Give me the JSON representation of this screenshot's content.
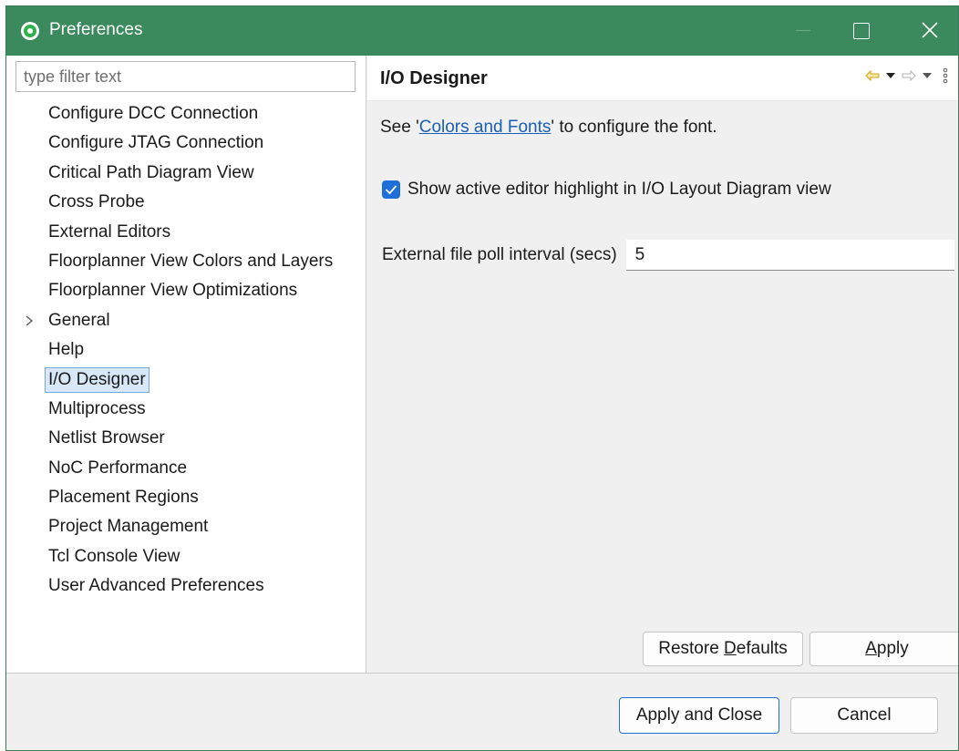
{
  "window": {
    "title": "Preferences",
    "accent_color": "#3a8a5e",
    "icons": [
      "app-logo-icon",
      "maximize-icon",
      "close-icon"
    ]
  },
  "filter": {
    "placeholder": "type filter text",
    "value": ""
  },
  "tree": {
    "items": [
      {
        "label": "Configure DCC Connection",
        "expandable": false,
        "selected": false
      },
      {
        "label": "Configure JTAG Connection",
        "expandable": false,
        "selected": false
      },
      {
        "label": "Critical Path Diagram View",
        "expandable": false,
        "selected": false
      },
      {
        "label": "Cross Probe",
        "expandable": false,
        "selected": false
      },
      {
        "label": "External Editors",
        "expandable": false,
        "selected": false
      },
      {
        "label": "Floorplanner View Colors and Layers",
        "expandable": false,
        "selected": false
      },
      {
        "label": "Floorplanner View Optimizations",
        "expandable": false,
        "selected": false
      },
      {
        "label": "General",
        "expandable": true,
        "selected": false
      },
      {
        "label": "Help",
        "expandable": false,
        "selected": false
      },
      {
        "label": "I/O Designer",
        "expandable": false,
        "selected": true
      },
      {
        "label": "Multiprocess",
        "expandable": false,
        "selected": false
      },
      {
        "label": "Netlist Browser",
        "expandable": false,
        "selected": false
      },
      {
        "label": "NoC Performance",
        "expandable": false,
        "selected": false
      },
      {
        "label": "Placement Regions",
        "expandable": false,
        "selected": false
      },
      {
        "label": "Project Management",
        "expandable": false,
        "selected": false
      },
      {
        "label": "Tcl Console View",
        "expandable": false,
        "selected": false
      },
      {
        "label": "User Advanced Preferences",
        "expandable": false,
        "selected": false
      }
    ]
  },
  "page": {
    "title": "I/O Designer",
    "desc_prefix": "See '",
    "desc_link": "Colors and Fonts",
    "desc_suffix": "' to configure the font.",
    "checkbox_label": "Show active editor highlight in I/O Layout Diagram view",
    "checkbox_checked": true,
    "poll_label": "External file poll interval (secs)",
    "poll_value": "5",
    "nav_icons": [
      "back-arrow-icon",
      "dropdown-icon",
      "forward-arrow-icon",
      "dropdown-icon",
      "more-icon"
    ]
  },
  "buttons": {
    "restore_prefix": "Restore ",
    "restore_mnemonic": "D",
    "restore_suffix": "efaults",
    "apply_mnemonic": "A",
    "apply_suffix": "pply",
    "apply_close": "Apply and Close",
    "cancel": "Cancel"
  }
}
